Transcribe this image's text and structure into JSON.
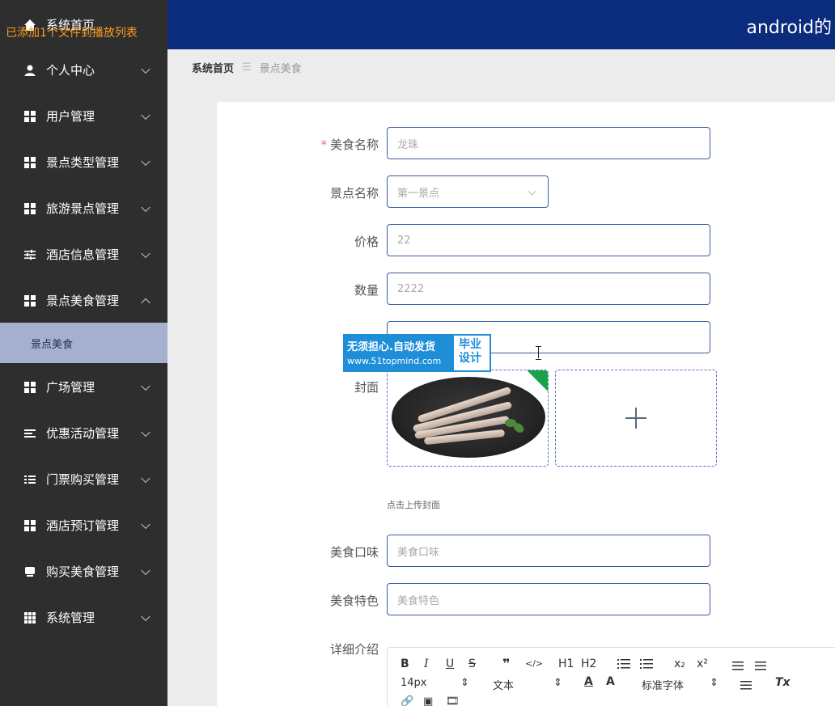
{
  "toast": "已添加1个文件到播放列表",
  "app": {
    "title": "android的"
  },
  "breadcrumb": {
    "home": "系统首页",
    "separator": "☰",
    "current": "景点美食"
  },
  "sidebar": {
    "home": "系统首页",
    "items": [
      {
        "label": "个人中心",
        "icon": "user-icon"
      },
      {
        "label": "用户管理",
        "icon": "grid-icon"
      },
      {
        "label": "景点类型管理",
        "icon": "grid-icon"
      },
      {
        "label": "旅游景点管理",
        "icon": "grid-icon"
      },
      {
        "label": "酒店信息管理",
        "icon": "sliders-icon"
      },
      {
        "label": "景点美食管理",
        "icon": "grid-icon",
        "expanded": true
      },
      {
        "label": "广场管理",
        "icon": "grid-icon"
      },
      {
        "label": "优惠活动管理",
        "icon": "list-icon"
      },
      {
        "label": "门票购买管理",
        "icon": "list-icon"
      },
      {
        "label": "酒店预订管理",
        "icon": "grid-icon"
      },
      {
        "label": "购买美食管理",
        "icon": "cart-icon"
      },
      {
        "label": "系统管理",
        "icon": "grid9-icon"
      }
    ],
    "subitem": "景点美食"
  },
  "form": {
    "food_name": {
      "label": "美食名称",
      "required_mark": "*",
      "value": "龙珠"
    },
    "spot_name": {
      "label": "景点名称",
      "value": "第一景点"
    },
    "price": {
      "label": "价格",
      "value": "22"
    },
    "quantity": {
      "label": "数量",
      "value": "2222"
    },
    "cover": {
      "label": "封面",
      "hint": "点击上传封面"
    },
    "taste": {
      "label": "美食口味",
      "placeholder": "美食口味"
    },
    "feature": {
      "label": "美食特色",
      "placeholder": "美食特色"
    },
    "detail": {
      "label": "详细介绍"
    }
  },
  "watermark": {
    "line1": "无须担心.自动发货",
    "line2": "www.51topmind.com",
    "badge1": "毕业",
    "badge2": "设计"
  },
  "editor": {
    "bold": "B",
    "italic": "I",
    "underline": "U",
    "strike": "S",
    "quote": "❞",
    "code": "</>",
    "h1": "H1",
    "h2": "H2",
    "sub": "x₂",
    "sup": "x²",
    "size": "14px",
    "format": "文本",
    "font": "标准字体",
    "clear": "Tx",
    "link": "🔗",
    "image": "▣",
    "video": "🎞"
  },
  "colors": {
    "sidebar_bg": "#2e2e2e",
    "header_bg": "#0b2c7d",
    "active_sub_bg": "#a5b0ce",
    "toast": "#ff9b22",
    "input_border": "#3f5aa8"
  }
}
